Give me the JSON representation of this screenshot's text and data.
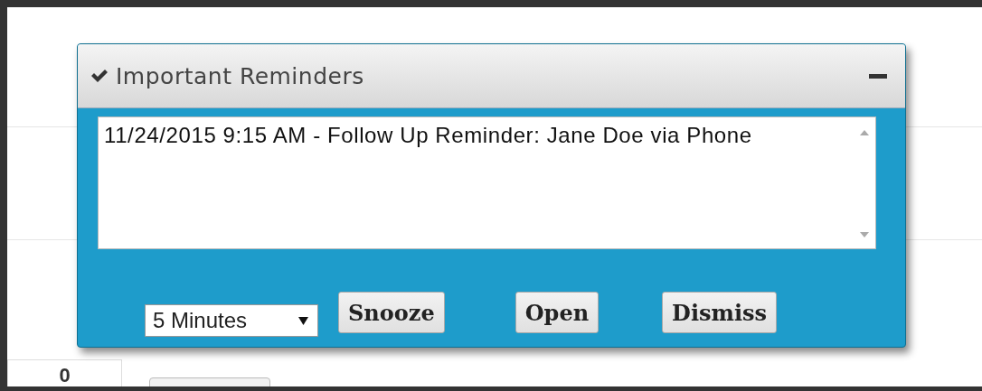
{
  "background": {
    "cell_value": "0"
  },
  "dialog": {
    "title": "Important Reminders",
    "reminders": [
      "11/24/2015 9:15 AM - Follow Up Reminder: Jane Doe via Phone"
    ],
    "snooze_select": {
      "value": "5 Minutes"
    },
    "buttons": [
      {
        "label": "Snooze"
      },
      {
        "label": "Open"
      },
      {
        "label": "Dismiss"
      }
    ]
  }
}
